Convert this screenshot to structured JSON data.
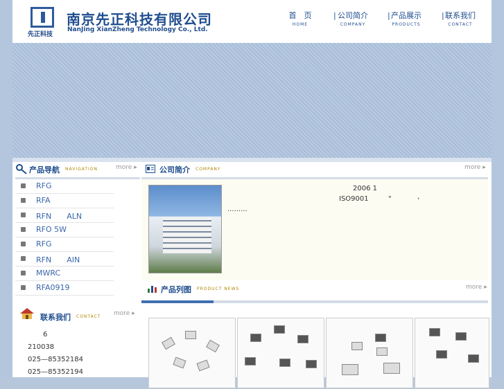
{
  "header": {
    "company_cn": "南京先正科技有限公司",
    "company_en": "NanJing XianZheng Technology Co., Ltd.",
    "logo_text": "先正科技"
  },
  "nav": [
    {
      "cn": "首　页",
      "en": "HOME"
    },
    {
      "cn": "公司简介",
      "en": "COMPANY"
    },
    {
      "cn": "产品展示",
      "en": "PRODUCTS"
    },
    {
      "cn": "联系我们",
      "en": "CONTACT"
    }
  ],
  "nav_separator": "|",
  "product_nav": {
    "title": "产品导航",
    "title_en": "NAVIGATION",
    "more": "more",
    "items": [
      "RFG",
      "RFA",
      "RFN　　ALN",
      "RFO 5W",
      "RFG",
      "RFN　　AIN",
      "MWRC",
      "RFA0919"
    ]
  },
  "contact": {
    "title": "联系我们",
    "title_en": "CONTACT",
    "more": "more",
    "lines": [
      "6",
      "210038",
      "025—85352184",
      "025—85352194"
    ]
  },
  "company": {
    "title": "公司简介",
    "title_en": "COMPANY",
    "more": "more",
    "text_line1": "2006 1",
    "text_line2a": "ISO9001",
    "text_line2b": "\"",
    "text_line2c": "‚",
    "text_line3": "........."
  },
  "product_list": {
    "title": "产品列图",
    "title_en": "PRODUCT NEWS",
    "more": "more"
  },
  "colors": {
    "brand": "#1f4d8e",
    "accent": "#b08600",
    "page_bg": "#b6c7dc"
  }
}
